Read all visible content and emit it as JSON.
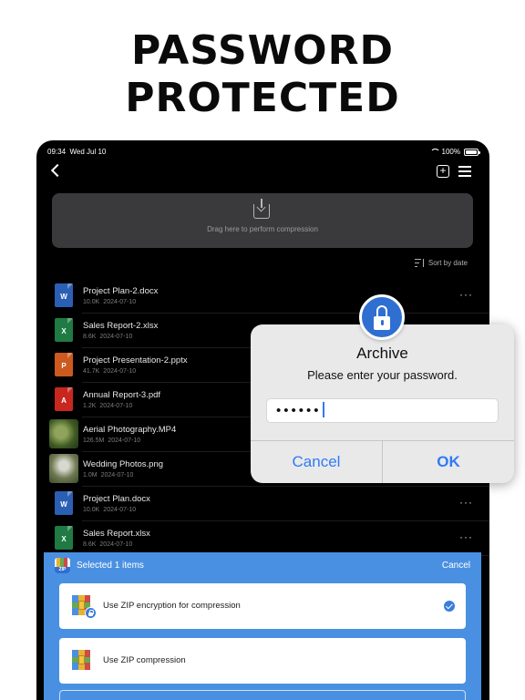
{
  "headline": {
    "line1": "PASSWORD",
    "line2": "PROTECTED"
  },
  "status": {
    "time": "09:34",
    "date": "Wed Jul 10",
    "battery": "100%"
  },
  "dropzone": {
    "text": "Drag here to perform compression"
  },
  "sort": {
    "label": "Sort by date"
  },
  "files": [
    {
      "name": "Project Plan-2.docx",
      "size": "10.0K",
      "date": "2024-07-10",
      "kind": "word",
      "glyph": "W",
      "color": "#2b5fb4"
    },
    {
      "name": "Sales Report-2.xlsx",
      "size": "8.6K",
      "date": "2024-07-10",
      "kind": "excel",
      "glyph": "X",
      "color": "#1f7a43"
    },
    {
      "name": "Project Presentation-2.pptx",
      "size": "41.7K",
      "date": "2024-07-10",
      "kind": "powerpoint",
      "glyph": "P",
      "color": "#cc5a1e"
    },
    {
      "name": "Annual Report-3.pdf",
      "size": "1.2K",
      "date": "2024-07-10",
      "kind": "pdf",
      "glyph": "A",
      "color": "#c8271f"
    },
    {
      "name": "Aerial Photography.MP4",
      "size": "126.5M",
      "date": "2024-07-10",
      "kind": "video",
      "glyph": "",
      "color": "#4e6b2b"
    },
    {
      "name": "Wedding Photos.png",
      "size": "1.0M",
      "date": "2024-07-10",
      "kind": "image",
      "glyph": "",
      "color": "#7a8060"
    },
    {
      "name": "Project Plan.docx",
      "size": "10.0K",
      "date": "2024-07-10",
      "kind": "word",
      "glyph": "W",
      "color": "#2b5fb4"
    },
    {
      "name": "Sales Report.xlsx",
      "size": "8.6K",
      "date": "2024-07-10",
      "kind": "excel",
      "glyph": "X",
      "color": "#1f7a43"
    }
  ],
  "sheet": {
    "title": "Selected 1 items",
    "cancel": "Cancel",
    "options": [
      {
        "label": "Use ZIP encryption for compression",
        "selected": true
      },
      {
        "label": "Use ZIP compression",
        "selected": false
      }
    ]
  },
  "dialog": {
    "title": "Archive",
    "message": "Please enter your password.",
    "password_value": "••••••",
    "cancel": "Cancel",
    "ok": "OK"
  },
  "colors": {
    "accent": "#2f7bf6",
    "sheet": "#4a90e2",
    "dropzone": "#3a3a3c"
  }
}
